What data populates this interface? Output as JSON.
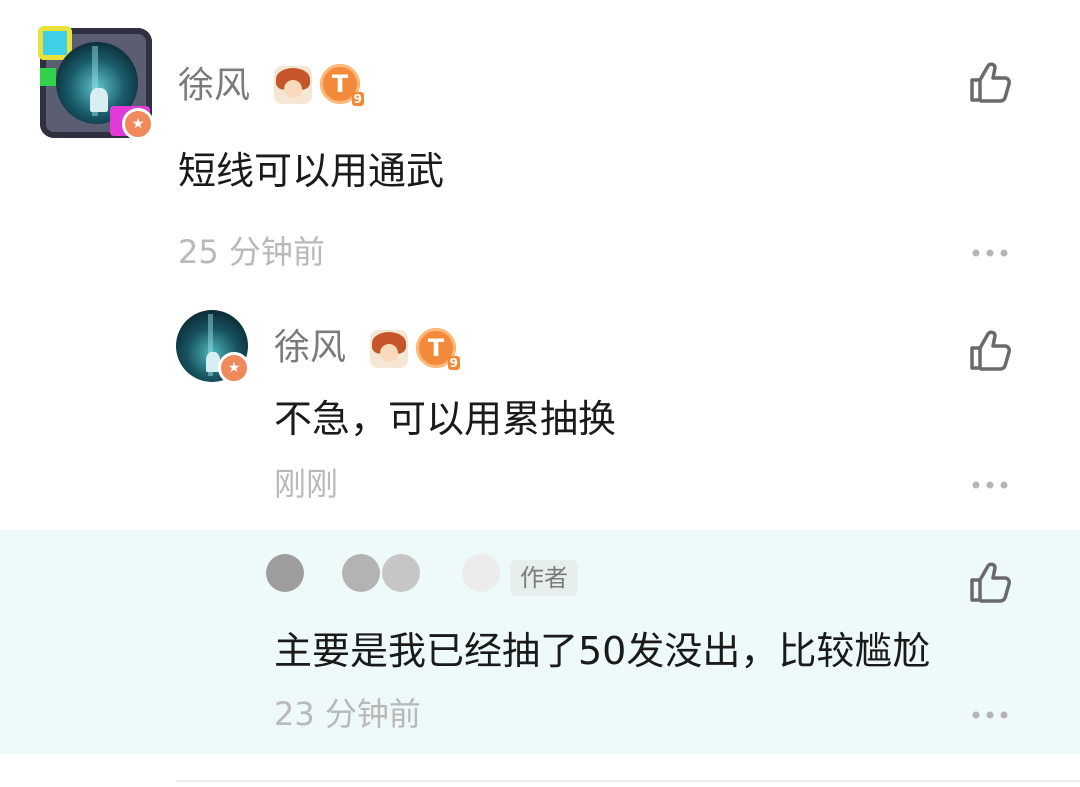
{
  "comments": [
    {
      "user": "徐风",
      "level_badge": "T",
      "level_num": "9",
      "text": "短线可以用通武",
      "time": "25 分钟前"
    },
    {
      "user": "徐风",
      "level_badge": "T",
      "level_num": "9",
      "text": "不急，可以用累抽换",
      "time": "刚刚"
    },
    {
      "author_tag": "作者",
      "text": "主要是我已经抽了50发没出，比较尴尬",
      "time": "23 分钟前"
    }
  ],
  "icons": {
    "like": "thumbs-up-icon",
    "more": "more-dots-icon",
    "verified": "verified-star-icon"
  },
  "colors": {
    "highlight_bg": "#eef9f9",
    "username": "#7b7b7b",
    "time": "#b9b9b9",
    "text": "#1a1a1a",
    "badge_orange": "#f28a3a"
  }
}
